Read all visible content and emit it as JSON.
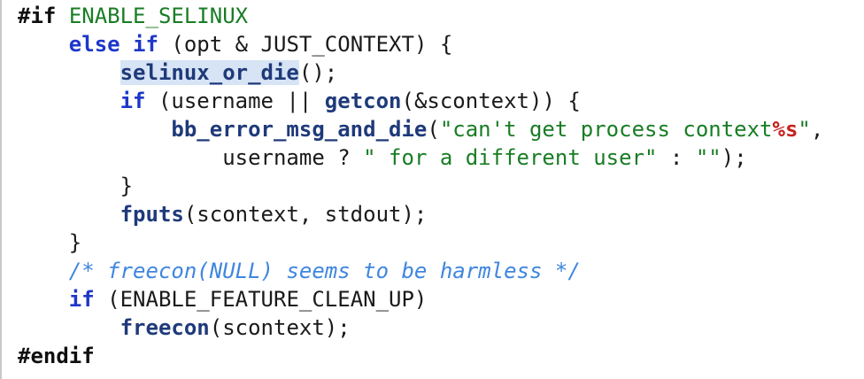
{
  "editor": {
    "lines": [
      {
        "indent": "",
        "tokens": [
          {
            "t": "#if",
            "c": "pp"
          },
          {
            "t": " ",
            "c": "p"
          },
          {
            "t": "ENABLE_SELINUX",
            "c": "macro"
          }
        ]
      },
      {
        "indent": "    ",
        "tokens": [
          {
            "t": "else",
            "c": "kw"
          },
          {
            "t": " ",
            "c": "p"
          },
          {
            "t": "if",
            "c": "kw"
          },
          {
            "t": " (opt & JUST_CONTEXT) {",
            "c": "p"
          }
        ]
      },
      {
        "indent": "        ",
        "tokens": [
          {
            "t": "selinux_or_die",
            "c": "fn",
            "sel": true
          },
          {
            "t": "();",
            "c": "p"
          }
        ]
      },
      {
        "indent": "        ",
        "tokens": [
          {
            "t": "if",
            "c": "kw"
          },
          {
            "t": " (username || ",
            "c": "p"
          },
          {
            "t": "getcon",
            "c": "fn"
          },
          {
            "t": "(&scontext)) {",
            "c": "p"
          }
        ]
      },
      {
        "indent": "            ",
        "tokens": [
          {
            "t": "bb_error_msg_and_die",
            "c": "fn"
          },
          {
            "t": "(",
            "c": "p"
          },
          {
            "t": "\"can't get process context",
            "c": "str"
          },
          {
            "t": "%s",
            "c": "fmt"
          },
          {
            "t": "\"",
            "c": "str"
          },
          {
            "t": ",",
            "c": "p"
          }
        ]
      },
      {
        "indent": "                ",
        "tokens": [
          {
            "t": "username ? ",
            "c": "p"
          },
          {
            "t": "\" for a different user\"",
            "c": "str"
          },
          {
            "t": " : ",
            "c": "p"
          },
          {
            "t": "\"\"",
            "c": "str"
          },
          {
            "t": ");",
            "c": "p"
          }
        ]
      },
      {
        "indent": "        ",
        "tokens": [
          {
            "t": "}",
            "c": "p"
          }
        ]
      },
      {
        "indent": "        ",
        "tokens": [
          {
            "t": "fputs",
            "c": "fn"
          },
          {
            "t": "(scontext, stdout);",
            "c": "p"
          }
        ]
      },
      {
        "indent": "    ",
        "tokens": [
          {
            "t": "}",
            "c": "p"
          }
        ]
      },
      {
        "indent": "    ",
        "tokens": [
          {
            "t": "/* freecon(NULL) seems to be harmless */",
            "c": "cm"
          }
        ]
      },
      {
        "indent": "    ",
        "tokens": [
          {
            "t": "if",
            "c": "kw"
          },
          {
            "t": " (ENABLE_FEATURE_CLEAN_UP)",
            "c": "p"
          }
        ]
      },
      {
        "indent": "        ",
        "tokens": [
          {
            "t": "freecon",
            "c": "fn"
          },
          {
            "t": "(scontext);",
            "c": "p"
          }
        ]
      },
      {
        "indent": "",
        "tokens": [
          {
            "t": "#endif",
            "c": "pp"
          }
        ]
      }
    ]
  },
  "colors": {
    "keyword": "#1e37c8",
    "function": "#1f3a7a",
    "string": "#187d24",
    "format_specifier": "#c7221f",
    "comment": "#3f86e0",
    "selection": "#d7e4f5"
  }
}
